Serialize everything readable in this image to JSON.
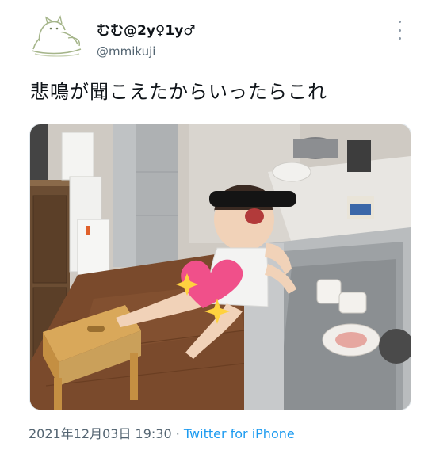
{
  "tweet": {
    "display_name": "むむ@2y♀1y♂",
    "handle": "@mmikuji",
    "text": "悲鳴が聞こえたからいったらこれ",
    "timestamp": "2021年12月03日 19:30",
    "separator": " · ",
    "source": "Twitter for iPhone",
    "media_description_icon": "photo-crying-toddler-on-sink"
  },
  "colors": {
    "text_primary": "#0f1419",
    "text_secondary": "#536471",
    "link": "#1d9bf0",
    "heart_sticker": "#f0508a",
    "sparkle": "#ffd23f"
  }
}
